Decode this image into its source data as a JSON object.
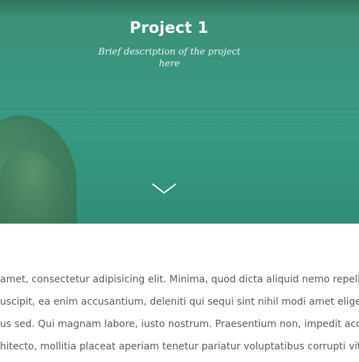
{
  "hero": {
    "title": "Project 1",
    "subtitle": "Brief description of the project here",
    "scroll_icon": "chevron-down-icon",
    "overlay_color": "#3a957e"
  },
  "content": {
    "lines": [
      "amet, consectetur adipisicing elit. Minima, quod dicta aliquid nemo repellendus",
      "uscipit, ea enim accusantium, deleniti qui sequi sint nihil modi amet eligendi",
      "us sed. Qui magnam labore, iusto nostrum. Praesentium non, impedit accusamus",
      "hitecto, mollitia placeat aperiam tenetur pariatur voluptatibus corrupti vitae"
    ]
  }
}
